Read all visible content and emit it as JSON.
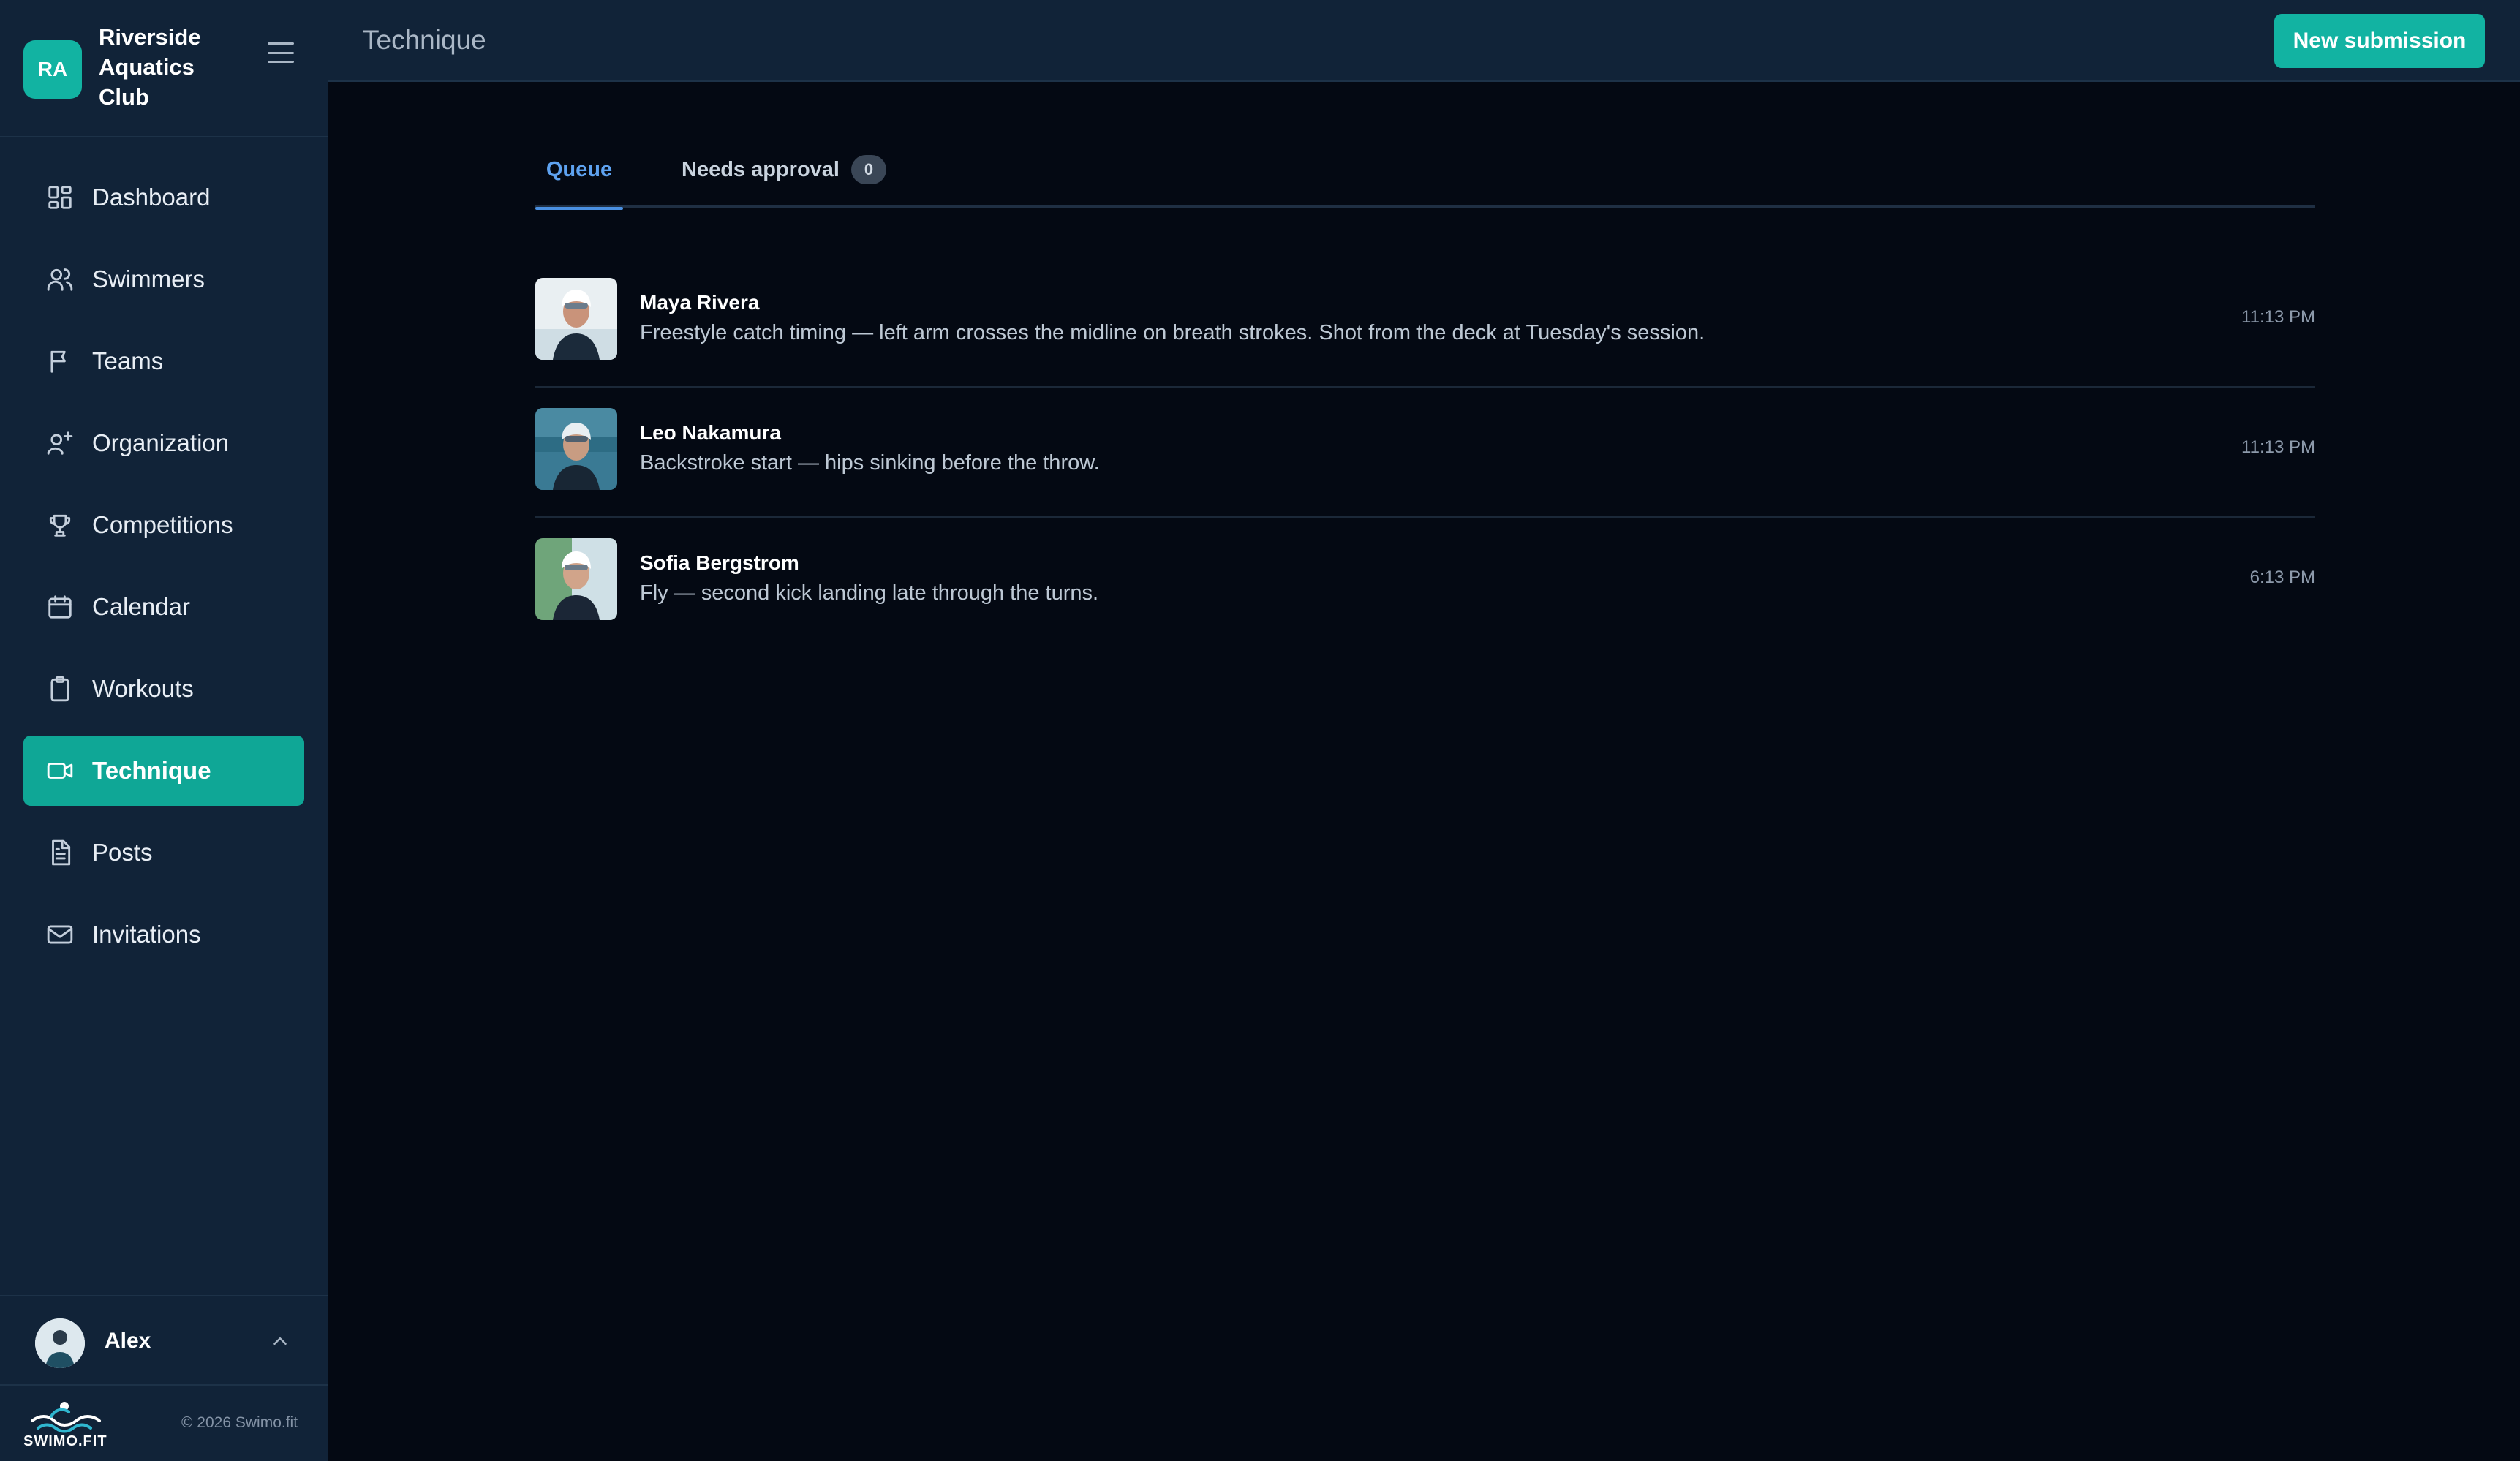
{
  "brand": {
    "initials": "RA",
    "name": "Riverside Aquatics Club"
  },
  "sidebar": {
    "items": [
      {
        "label": "Dashboard",
        "icon": "dashboard-icon",
        "active": false
      },
      {
        "label": "Swimmers",
        "icon": "users-icon",
        "active": false
      },
      {
        "label": "Teams",
        "icon": "flag-icon",
        "active": false
      },
      {
        "label": "Organization",
        "icon": "user-plus-icon",
        "active": false
      },
      {
        "label": "Competitions",
        "icon": "trophy-icon",
        "active": false
      },
      {
        "label": "Calendar",
        "icon": "calendar-icon",
        "active": false
      },
      {
        "label": "Workouts",
        "icon": "clipboard-icon",
        "active": false
      },
      {
        "label": "Technique",
        "icon": "video-icon",
        "active": true
      },
      {
        "label": "Posts",
        "icon": "document-icon",
        "active": false
      },
      {
        "label": "Invitations",
        "icon": "mail-icon",
        "active": false
      }
    ],
    "user": {
      "name": "Alex"
    },
    "footer": {
      "logo_text": "SWIMO.FIT",
      "copyright": "© 2026 Swimo.fit"
    }
  },
  "header": {
    "title": "Technique",
    "new_submission_label": "New submission"
  },
  "tabs": {
    "queue_label": "Queue",
    "approval_label": "Needs approval",
    "approval_count": "0"
  },
  "submissions": [
    {
      "name": "Maya Rivera",
      "description": "Freestyle catch timing — left arm crosses the midline on breath strokes. Shot from the deck at Tuesday's session.",
      "time": "11:13 PM"
    },
    {
      "name": "Leo Nakamura",
      "description": "Backstroke start — hips sinking before the throw.",
      "time": "11:13 PM"
    },
    {
      "name": "Sofia Bergstrom",
      "description": "Fly — second kick landing late through the turns.",
      "time": "6:13 PM"
    }
  ],
  "colors": {
    "accent": "#12b3a2",
    "sidebar_bg": "#112338",
    "page_bg": "#040913",
    "tab_active": "#5ea2f0"
  }
}
